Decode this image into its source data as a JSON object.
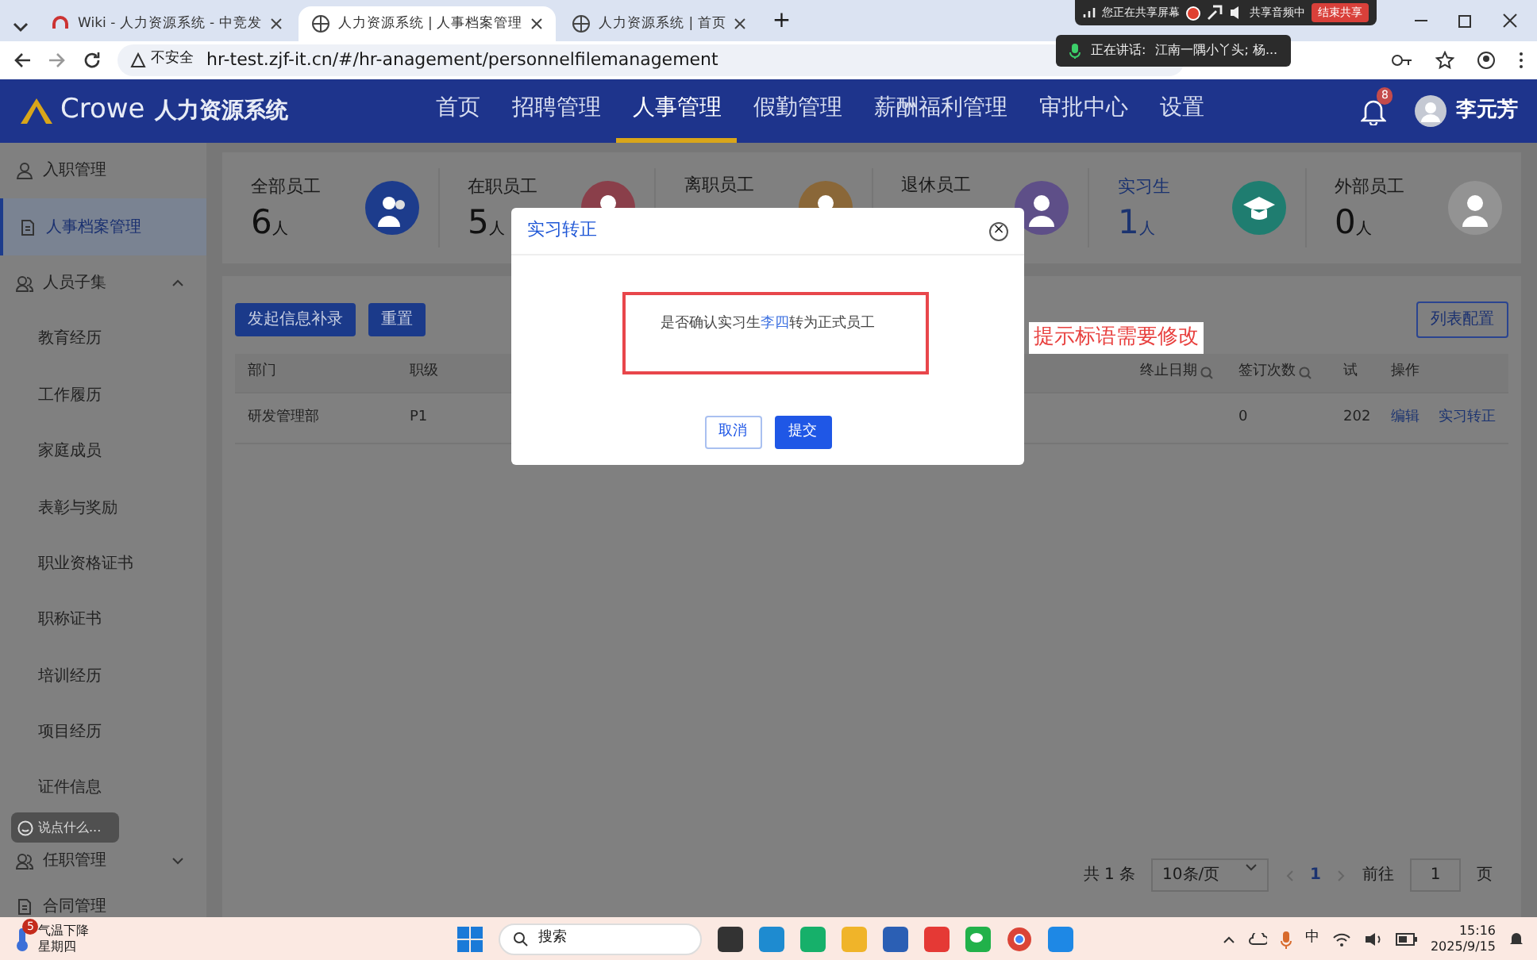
{
  "browser": {
    "tabs": [
      {
        "title": "Wiki - 人力资源系统 - 中竞发",
        "selected": false
      },
      {
        "title": "人力资源系统 | 人事档案管理",
        "selected": true
      },
      {
        "title": "人力资源系统 | 首页",
        "selected": false
      }
    ],
    "new_tab": "+",
    "security": "不安全",
    "url": "hr-test.zjf-it.cn/#/hr-anagement/personnelfilemanagement"
  },
  "screen_share": {
    "status": "您正在共享屏幕",
    "audio": "共享音频中",
    "stop_button": "结束共享",
    "speaking_label": "正在讲话:",
    "speakers": "江南一隅小丫头; 杨..."
  },
  "app": {
    "logo_text": "Crowe",
    "system_name": "人力资源系统",
    "nav": [
      {
        "label": "首页",
        "selected": false
      },
      {
        "label": "招聘管理",
        "selected": false
      },
      {
        "label": "人事管理",
        "selected": true
      },
      {
        "label": "假勤管理",
        "selected": false
      },
      {
        "label": "薪酬福利管理",
        "selected": false
      },
      {
        "label": "审批中心",
        "selected": false
      },
      {
        "label": "设置",
        "selected": false
      }
    ],
    "notification_count": "8",
    "user": "李元芳"
  },
  "sidebar": {
    "items": [
      {
        "label": "入职管理",
        "kind": "top",
        "selected": false
      },
      {
        "label": "人事档案管理",
        "kind": "top",
        "selected": true
      },
      {
        "label": "人员子集",
        "kind": "group",
        "selected": false,
        "expanded": true,
        "children": [
          {
            "label": "教育经历",
            "selected": false
          },
          {
            "label": "工作履历",
            "selected": false
          },
          {
            "label": "家庭成员",
            "selected": false
          },
          {
            "label": "表彰与奖励",
            "selected": false
          },
          {
            "label": "职业资格证书",
            "selected": false
          },
          {
            "label": "职称证书",
            "selected": false
          },
          {
            "label": "培训经历",
            "selected": false
          },
          {
            "label": "项目经历",
            "selected": false
          },
          {
            "label": "证件信息",
            "selected": false
          }
        ]
      },
      {
        "label": "任职管理",
        "kind": "group",
        "selected": false,
        "expanded": false
      },
      {
        "label": "合同管理",
        "kind": "top",
        "selected": false
      }
    ]
  },
  "stats": [
    {
      "label": "全部员工",
      "count": "6",
      "unit": "人",
      "color": "#1d3c8c",
      "selected": false
    },
    {
      "label": "在职员工",
      "count": "5",
      "unit": "人",
      "color": "#8a3f4a",
      "selected": false
    },
    {
      "label": "离职员工",
      "color": "#8a6738",
      "selected": false
    },
    {
      "label": "退休员工",
      "color": "#5e4f88",
      "selected": false
    },
    {
      "label": "实习生",
      "count": "1",
      "unit": "人",
      "color": "#1f7d70",
      "selected": true
    },
    {
      "label": "外部员工",
      "count": "0",
      "unit": "人",
      "color": "#939393",
      "selected": false
    }
  ],
  "toolbar": {
    "buttons": [
      "发起信息补录",
      "重置"
    ],
    "config_button": "列表配置"
  },
  "table": {
    "columns": [
      "部门",
      "职级",
      "终止日期",
      "签订次数",
      "试",
      "操作"
    ],
    "rows": [
      {
        "cells": [
          "研发管理部",
          "P1",
          null,
          "0",
          "202"
        ],
        "actions": [
          "编辑",
          "实习转正"
        ]
      }
    ]
  },
  "pagination": {
    "total": "共 1 条",
    "page_size": "10条/页",
    "pages": [
      {
        "label": "1",
        "selected": true
      }
    ],
    "goto_label": "前往",
    "goto_value": "1",
    "goto_suffix": "页"
  },
  "dialog": {
    "title": "实习转正",
    "close": "×",
    "message": {
      "before": "是否确认实习生",
      "name": "李四",
      "after": "转为正式员工"
    },
    "buttons": [
      {
        "label": "取消",
        "kind": "secondary"
      },
      {
        "label": "提交",
        "kind": "primary"
      }
    ]
  },
  "annotation": "提示标语需要修改",
  "chat_bubble": "说点什么...",
  "taskbar": {
    "weather_badge": "5",
    "weather": "气温下降",
    "weekday": "星期四",
    "search": "搜索",
    "ime": "中",
    "time": "15:16",
    "date": "2025/9/15"
  }
}
